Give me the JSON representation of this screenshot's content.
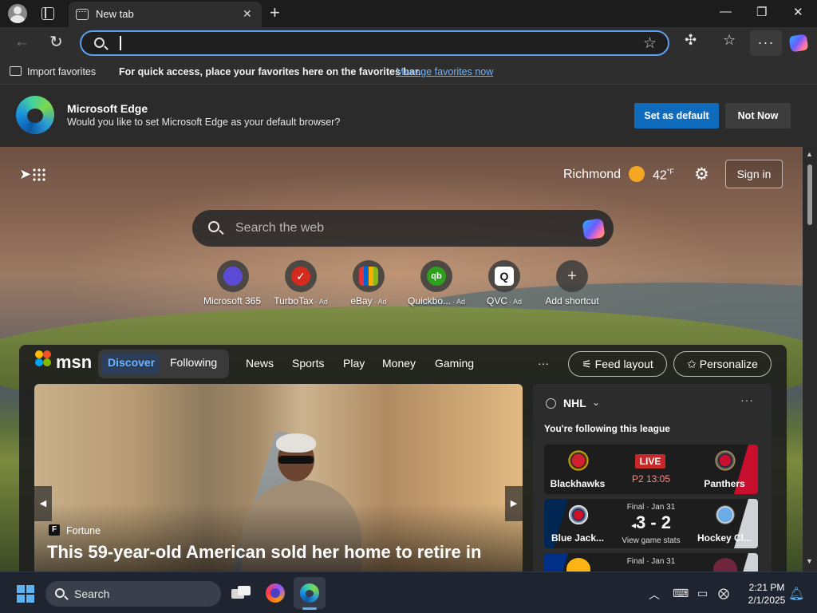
{
  "browser": {
    "tab_title": "New tab",
    "address_value": "",
    "window_controls": {
      "minimize": "—",
      "restore": "❐",
      "close": "✕"
    }
  },
  "favorites_bar": {
    "import_label": "Import favorites",
    "info_text": "For quick access, place your favorites here on the favorites bar.",
    "manage_link": "Manage favorites now"
  },
  "default_banner": {
    "title": "Microsoft Edge",
    "subtitle": "Would you like to set Microsoft Edge as your default browser?",
    "set_default_label": "Set as default",
    "not_now_label": "Not Now"
  },
  "newtab": {
    "weather": {
      "city": "Richmond",
      "temp": "42",
      "unit": "°F"
    },
    "sign_in_label": "Sign in",
    "search_placeholder": "Search the web",
    "shortcuts": [
      {
        "label": "Microsoft 365",
        "ad": "",
        "color": "#5b4bd6"
      },
      {
        "label": "TurboTax",
        "ad": "· Ad",
        "color": "#d52b1e"
      },
      {
        "label": "eBay",
        "ad": "· Ad",
        "color": "#111111"
      },
      {
        "label": "Quickbo...",
        "ad": "· Ad",
        "color": "#2ca01c"
      },
      {
        "label": "QVC",
        "ad": "· Ad",
        "color": "#ffffff"
      },
      {
        "label": "Add shortcut",
        "ad": "",
        "color": "#555555"
      }
    ]
  },
  "msn": {
    "logo": "msn",
    "tabs": {
      "discover": "Discover",
      "following": "Following"
    },
    "nav": [
      "News",
      "Sports",
      "Play",
      "Money",
      "Gaming"
    ],
    "more": "···",
    "feed_layout_label": "Feed layout",
    "personalize_label": "Personalize",
    "hero": {
      "source": "Fortune",
      "headline": "This 59-year-old American sold her home to retire in"
    },
    "nhl": {
      "title": "NHL",
      "following_text": "You're following this league",
      "games": [
        {
          "home": "Blackhawks",
          "away": "Panthers",
          "badge": "LIVE",
          "clock": "P2 13:05"
        },
        {
          "home": "Blue Jack...",
          "away": "Hockey Cl...",
          "status": "Final · Jan 31",
          "score": "3 - 2",
          "winner_marker": "◂",
          "link": "View game stats"
        },
        {
          "status": "Final · Jan 31"
        }
      ]
    }
  },
  "taskbar": {
    "search_label": "Search",
    "time": "2:21 PM",
    "date": "2/1/2025"
  }
}
